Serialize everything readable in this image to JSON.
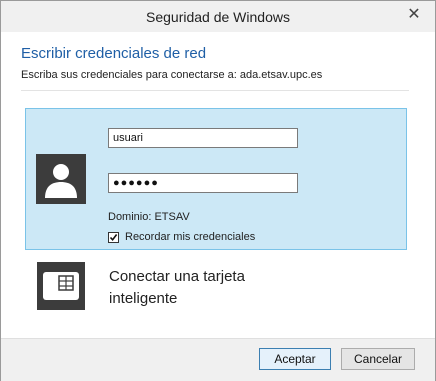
{
  "window": {
    "title": "Seguridad de Windows",
    "close_glyph": "✕"
  },
  "header": {
    "title": "Escribir credenciales de red",
    "subtitle": "Escriba sus credenciales para conectarse a: ada.etsav.upc.es"
  },
  "credential": {
    "username_value": "usuari",
    "password_value": "●●●●●●",
    "domain_text": "Dominio: ETSAV",
    "remember_label": "Recordar mis credenciales",
    "remember_checked": true,
    "avatar_icon": "user-icon",
    "selected_color": "#cce8f6"
  },
  "smartcard": {
    "label": "Conectar una tarjeta inteligente",
    "icon": "smartcard-icon"
  },
  "footer": {
    "accept_label": "Aceptar",
    "cancel_label": "Cancelar"
  },
  "colors": {
    "accent": "#1f5fa6",
    "tile_border": "#7ac3e8"
  }
}
